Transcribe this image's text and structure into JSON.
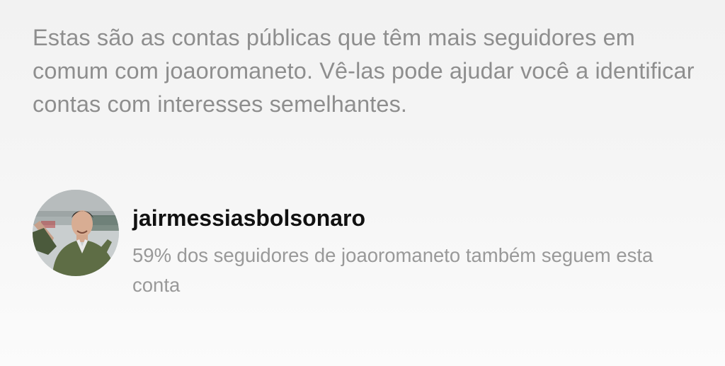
{
  "intro_text": "Estas são as contas públicas que têm mais seguidores em comum com joaoromaneto. Vê-las pode ajudar você a identificar contas com interesses semelhantes.",
  "account": {
    "username": "jairmessiasbolsonaro",
    "description": "59% dos seguidores de joaoromaneto também seguem esta conta"
  }
}
